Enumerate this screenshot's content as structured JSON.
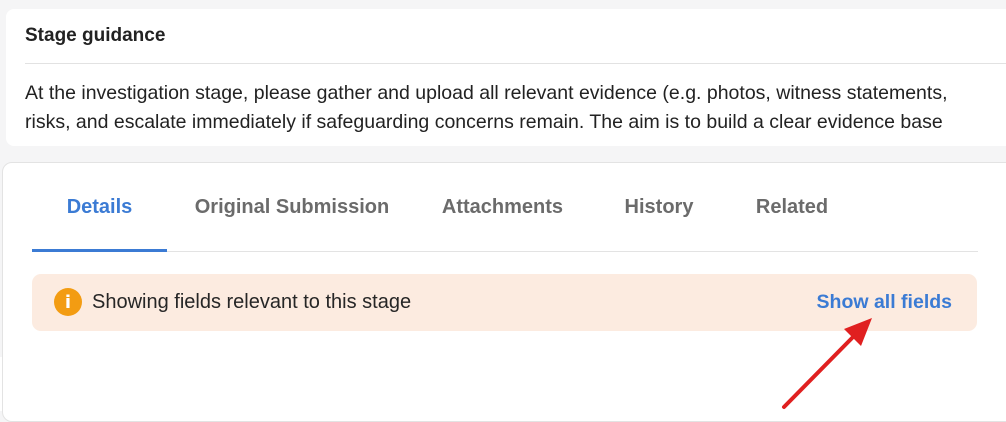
{
  "guidance": {
    "title": "Stage guidance",
    "line1": "At the investigation stage, please gather and upload all relevant evidence (e.g. photos, witness statements, ",
    "line2": "risks, and escalate immediately if safeguarding concerns remain. The aim is to build a clear evidence base"
  },
  "tabs": [
    {
      "label": "Details"
    },
    {
      "label": "Original Submission"
    },
    {
      "label": "Attachments"
    },
    {
      "label": "History"
    },
    {
      "label": "Related"
    }
  ],
  "banner": {
    "icon": "info-icon",
    "icon_glyph": "i",
    "text": "Showing fields relevant to this stage",
    "action_label": "Show all fields"
  },
  "colors": {
    "accent": "#3b7bd4",
    "banner_bg": "#fcebe0",
    "info_icon": "#f39c12",
    "annotation_arrow": "#e02020"
  }
}
